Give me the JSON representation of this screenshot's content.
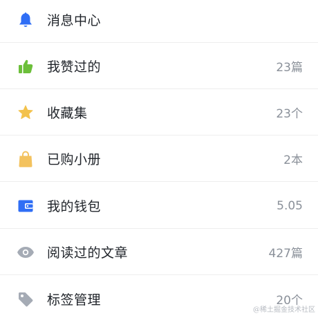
{
  "menu": {
    "items": [
      {
        "label": "消息中心",
        "value": "",
        "icon": "bell-icon"
      },
      {
        "label": "我赞过的",
        "value": "23篇",
        "icon": "thumbs-up-icon"
      },
      {
        "label": "收藏集",
        "value": "23个",
        "icon": "star-icon"
      },
      {
        "label": "已购小册",
        "value": "2本",
        "icon": "shopping-bag-icon"
      },
      {
        "label": "我的钱包",
        "value": "5.05",
        "icon": "wallet-icon"
      },
      {
        "label": "阅读过的文章",
        "value": "427篇",
        "icon": "eye-icon"
      },
      {
        "label": "标签管理",
        "value": "20个",
        "icon": "tag-icon"
      }
    ]
  },
  "watermark": "@稀土掘金技术社区",
  "colors": {
    "bell": "#2f6ef5",
    "thumbs_up": "#6cbf3a",
    "star": "#f3c24c",
    "bag": "#f3c25e",
    "wallet": "#2f6ef5",
    "eye": "#a5abb5",
    "tag": "#a5abb5",
    "label_text": "#1f2329",
    "value_text": "#8a9099",
    "separator": "#ededed"
  }
}
